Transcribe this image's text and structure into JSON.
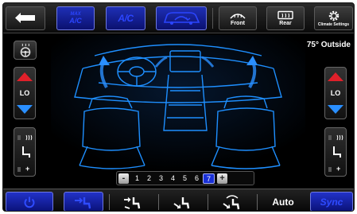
{
  "top_bar": {
    "back": {
      "icon": "back-arrow-icon"
    },
    "max_ac": {
      "label_line1": "MAX",
      "label_line2": "A/C"
    },
    "ac": {
      "label": "A/C"
    },
    "recirculation": {
      "icon": "recirculation-icon"
    },
    "front_defrost": {
      "label": "Front",
      "icon": "front-defrost-icon"
    },
    "rear_defrost": {
      "label": "Rear",
      "icon": "rear-defrost-icon"
    },
    "climate_settings": {
      "label": "Climate Settings",
      "icon": "gear-icon"
    }
  },
  "outside_temperature": "75° Outside",
  "driver": {
    "steering_heat": {
      "icon": "heated-steering-wheel-icon"
    },
    "temperature": "LO",
    "seat": {
      "heat_icon": "heated-seat-icon",
      "plus_label": "+"
    }
  },
  "passenger": {
    "temperature": "LO",
    "seat": {
      "heat_icon": "heated-seat-icon",
      "plus_label": "+"
    }
  },
  "fan": {
    "decrease_label": "-",
    "increase_label": "+",
    "levels": [
      "1",
      "2",
      "3",
      "4",
      "5",
      "6",
      "7"
    ],
    "selected_level": "7"
  },
  "bottom_bar": {
    "power": {
      "icon": "power-icon"
    },
    "modes": [
      {
        "icon": "panel-mode-icon",
        "active": true
      },
      {
        "icon": "bilevel-mode-icon",
        "active": false
      },
      {
        "icon": "floor-mode-icon",
        "active": false
      },
      {
        "icon": "mix-mode-icon",
        "active": false
      }
    ],
    "auto_label": "Auto",
    "sync_label": "Sync"
  },
  "colors": {
    "accent_blue": "#1f33c8",
    "glow_blue": "#1e8fff",
    "arrow_red": "#e0202a",
    "arrow_blue": "#2a8fff"
  }
}
